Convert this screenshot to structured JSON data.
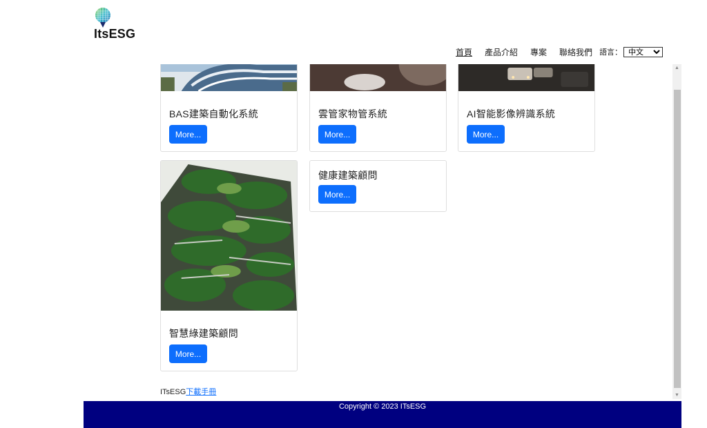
{
  "brand": {
    "name": "ItsESG"
  },
  "nav": {
    "items": [
      {
        "label": "首頁",
        "active": true
      },
      {
        "label": "產品介紹",
        "active": false
      },
      {
        "label": "專案",
        "active": false
      },
      {
        "label": "聯絡我們",
        "active": false
      }
    ],
    "language_label": "語言：",
    "language_selected": "中文"
  },
  "products": {
    "cards": [
      {
        "title": "BAS建築自動化系統",
        "button": "More..."
      },
      {
        "title": "雲管家物管系統",
        "button": "More..."
      },
      {
        "title": "AI智能影像辨識系統",
        "button": "More..."
      },
      {
        "title": "健康建築顧問",
        "button": "More..."
      },
      {
        "title": "智慧綠建築顧問",
        "button": "More..."
      }
    ]
  },
  "manual": {
    "prefix": "ITsESG",
    "link": "下載手冊"
  },
  "footer": {
    "copyright": "Copyright © 2023 ITsESG"
  },
  "colors": {
    "button": "#0d6efd",
    "footer": "#000080"
  }
}
